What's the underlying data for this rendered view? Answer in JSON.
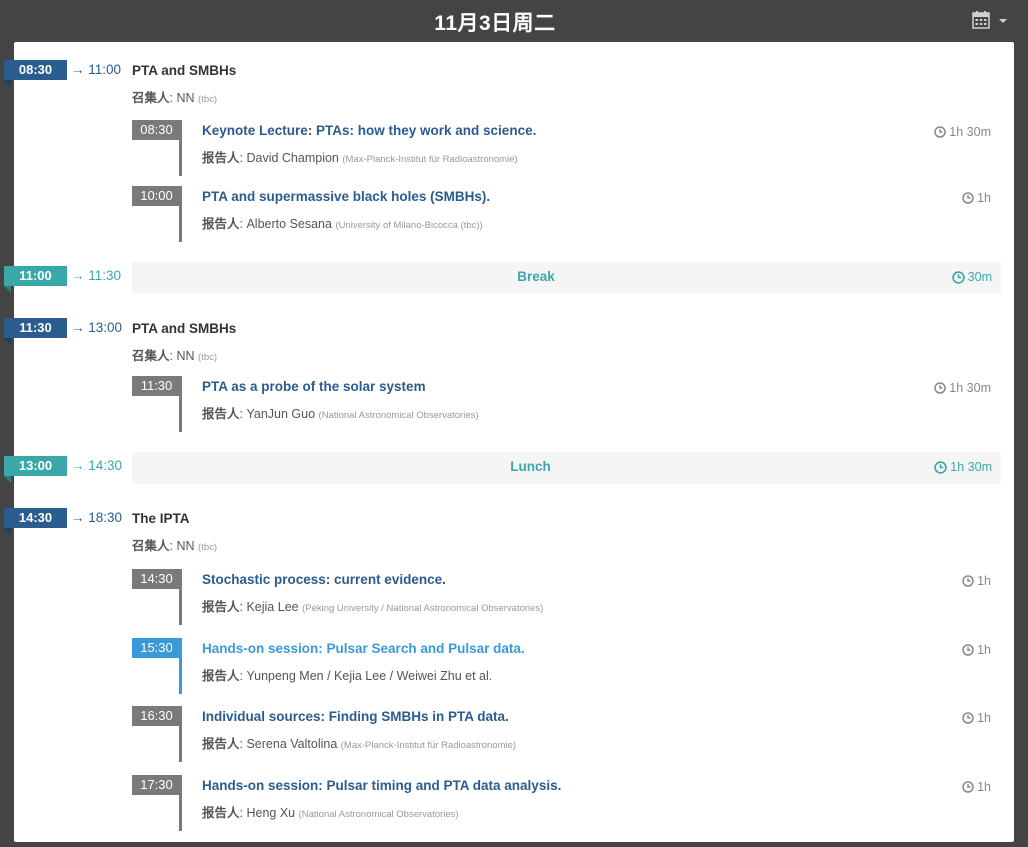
{
  "header": {
    "day_title": "11月3日周二",
    "calendar_icon": "calendar-icon",
    "dropdown_icon": "caret-down-icon"
  },
  "colors": {
    "session": "#2b5c8f",
    "break": "#3aa8a8",
    "talk_box": "#7a7a7a",
    "talk_highlight": "#3a9ad9",
    "background": "#444444"
  },
  "convener_label": "召集人",
  "speaker_label": "报告人",
  "sessions": [
    {
      "start": "08:30",
      "end": "→ 11:00",
      "title": "PTA and SMBHs",
      "convener": "NN",
      "convener_note": "(tbc)",
      "talks": [
        {
          "time": "08:30",
          "title": "Keynote Lecture: PTAs: how they work and science.",
          "speaker": "David Champion",
          "affiliation": "(Max-Planck-Institut für Radioastronomie)",
          "duration": "1h 30m"
        },
        {
          "time": "10:00",
          "title": "PTA and supermassive black holes (SMBHs).",
          "speaker": "Alberto Sesana",
          "affiliation": "(University of Milano-Bicocca (tbc))",
          "duration": "1h"
        }
      ]
    },
    {
      "start": "11:30",
      "end": "→ 13:00",
      "title": "PTA and SMBHs",
      "convener": "NN",
      "convener_note": "(tbc)",
      "talks": [
        {
          "time": "11:30",
          "title": "PTA as a probe of the solar system",
          "speaker": "YanJun Guo",
          "affiliation": "(National Astronomical Observatories)",
          "duration": "1h 30m"
        }
      ]
    },
    {
      "start": "14:30",
      "end": "→ 18:30",
      "title": "The IPTA",
      "convener": "NN",
      "convener_note": "(tbc)",
      "talks": [
        {
          "time": "14:30",
          "title": "Stochastic process: current evidence.",
          "speaker": "Kejia Lee",
          "affiliation": "(Peking University / National Astronomical Observatories)",
          "duration": "1h"
        },
        {
          "time": "15:30",
          "title": "Hands-on session: Pulsar Search and Pulsar data.",
          "speaker": "Yunpeng Men / Kejia Lee / Weiwei Zhu et al.",
          "affiliation": "",
          "duration": "1h"
        },
        {
          "time": "16:30",
          "title": "Individual sources: Finding SMBHs in PTA data.",
          "speaker": "Serena Valtolina",
          "affiliation": "(Max-Planck-Institut für Radioastronomie)",
          "duration": "1h"
        },
        {
          "time": "17:30",
          "title": "Hands-on session: Pulsar timing and PTA data analysis.",
          "speaker": "Heng Xu",
          "affiliation": "(National Astronomical Observatories)",
          "duration": "1h"
        }
      ]
    }
  ],
  "breaks": [
    {
      "start": "11:00",
      "end": "→ 11:30",
      "title": "Break",
      "duration": "30m"
    },
    {
      "start": "13:00",
      "end": "→ 14:30",
      "title": "Lunch",
      "duration": "1h 30m"
    }
  ]
}
